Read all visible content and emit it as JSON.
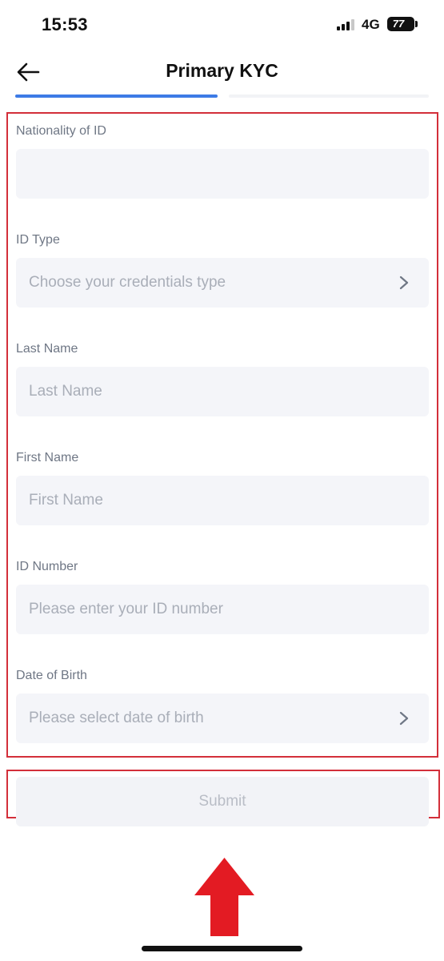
{
  "status_bar": {
    "time": "15:53",
    "network": "4G",
    "battery": "77"
  },
  "header": {
    "title": "Primary KYC",
    "back_icon": "arrow-left-icon"
  },
  "progress": {
    "total_steps": 2,
    "current_step": 1,
    "active_color": "#3d7be6",
    "inactive_color": "#f2f3f6"
  },
  "form": {
    "fields": [
      {
        "label": "Nationality of ID",
        "value": "",
        "placeholder": "",
        "icon": ""
      },
      {
        "label": "ID Type",
        "value": "",
        "placeholder": "Choose your credentials type",
        "icon": "chevron-right-icon"
      },
      {
        "label": "Last Name",
        "value": "",
        "placeholder": "Last Name",
        "icon": ""
      },
      {
        "label": "First Name",
        "value": "",
        "placeholder": "First Name",
        "icon": ""
      },
      {
        "label": "ID Number",
        "value": "",
        "placeholder": "Please enter your ID number",
        "icon": ""
      },
      {
        "label": "Date of Birth",
        "value": "",
        "placeholder": "Please select date of birth",
        "icon": "chevron-right-icon"
      }
    ]
  },
  "submit": {
    "label": "Submit",
    "enabled": false
  },
  "annotation": {
    "highlight_color": "#d32f3a",
    "arrow_color": "#e31b23",
    "arrow_icon": "arrow-up-icon"
  }
}
